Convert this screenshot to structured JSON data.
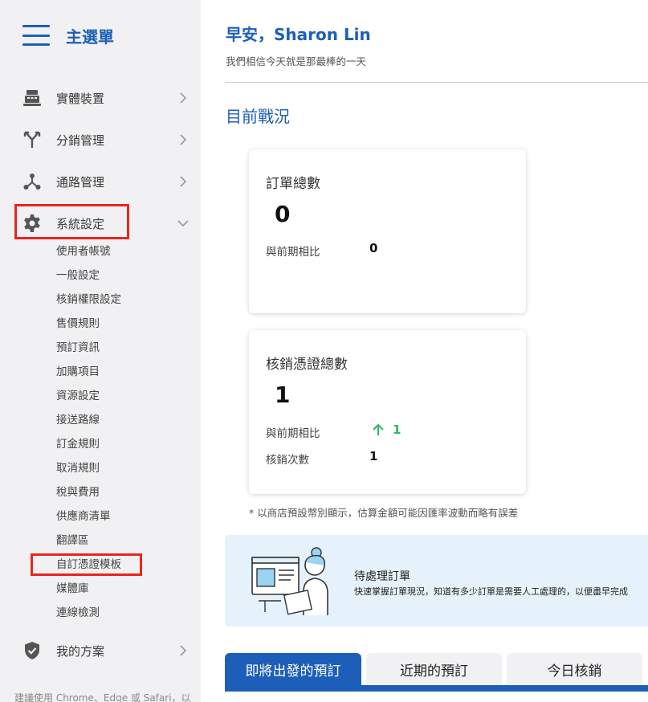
{
  "sidebar": {
    "menu_title": "主選單",
    "items": [
      {
        "label": "實體裝置"
      },
      {
        "label": "分銷管理"
      },
      {
        "label": "通路管理"
      },
      {
        "label": "系統設定"
      },
      {
        "label": "我的方案"
      }
    ],
    "system_settings_sub": [
      "使用者帳號",
      "一般設定",
      "核銷權限設定",
      "售價規則",
      "預訂資訊",
      "加購項目",
      "資源設定",
      "接送路線",
      "訂金規則",
      "取消規則",
      "稅與費用",
      "供應商清單",
      "翻譯區",
      "自訂憑證模板",
      "媒體庫",
      "連線檢測"
    ],
    "note": "建議使用 Chrome、Edge 或 Safari，以"
  },
  "header": {
    "greeting": "早安，Sharon Lin",
    "subtitle": "我們相信今天就是那最棒的一天"
  },
  "section_title": "目前戰況",
  "cards": {
    "orders": {
      "title": "訂單總數",
      "value": "0",
      "compare_label": "與前期相比",
      "compare_value": "0"
    },
    "vouchers": {
      "title": "核銷憑證總數",
      "value": "1",
      "compare_label": "與前期相比",
      "compare_value": "1",
      "count_label": "核銷次數",
      "count_value": "1"
    }
  },
  "footnote": "* 以商店預設幣別顯示，估算金額可能因匯率波動而略有誤差",
  "banner": {
    "title": "待處理訂單",
    "desc": "快速掌握訂單現況，知道有多少訂單是需要人工處理的，以便盡早完成"
  },
  "tabs": [
    "即將出發的預訂",
    "近期的預訂",
    "今日核銷"
  ],
  "colors": {
    "primary": "#1d5fb8",
    "highlight": "#e8251d",
    "up": "#2db56b",
    "sidebar_bg": "#f1f1f3",
    "banner_bg": "#e6f2fb"
  }
}
